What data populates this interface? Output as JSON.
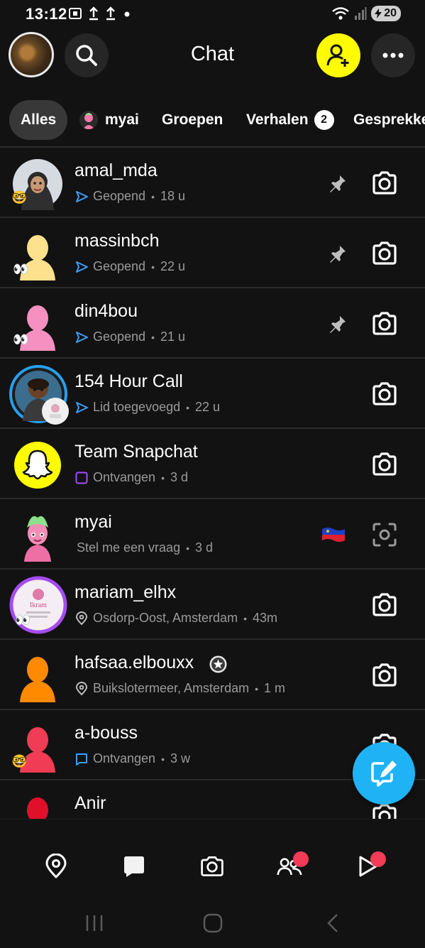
{
  "status_bar": {
    "time": "13:12",
    "battery": "20",
    "icons": [
      "screenshot-icon",
      "upload-icon",
      "upload-icon",
      "dot-icon",
      "wifi-icon",
      "signal-icon"
    ]
  },
  "header": {
    "title": "Chat"
  },
  "tabs": [
    {
      "label": "Alles",
      "active": true
    },
    {
      "label": "myai"
    },
    {
      "label": "Groepen"
    },
    {
      "label": "Verhalen",
      "badge": "2"
    },
    {
      "label": "Gesprekken"
    }
  ],
  "chats": [
    {
      "name": "amal_mda",
      "status_icon": "sent-arrow-blue",
      "status": "Geopend",
      "time": "18 u",
      "pinned": true,
      "action": "camera-icon"
    },
    {
      "name": "massinbch",
      "status_icon": "sent-arrow-blue",
      "status": "Geopend",
      "time": "22 u",
      "pinned": true,
      "action": "camera-icon"
    },
    {
      "name": "din4bou",
      "status_icon": "sent-arrow-blue",
      "status": "Geopend",
      "time": "21 u",
      "pinned": true,
      "action": "camera-icon"
    },
    {
      "name": "154 Hour Call",
      "status_icon": "sent-arrow-blue",
      "status": "Lid toegevoegd",
      "time": "22 u",
      "action": "camera-icon"
    },
    {
      "name": "Team Snapchat",
      "status_icon": "square-purple",
      "status": "Ontvangen",
      "time": "3 d",
      "action": "camera-icon"
    },
    {
      "name": "myai",
      "status": "Stel me een vraag",
      "time": "3 d",
      "flag": "liechtenstein-flag",
      "action": "scan-icon"
    },
    {
      "name": "mariam_elhx",
      "status_icon": "location-pin",
      "status": "Osdorp-Oost, Amsterdam",
      "time": "43m",
      "action": "camera-icon"
    },
    {
      "name": "hafsaa.elbouxx",
      "status_icon": "location-pin",
      "status": "Buikslotermeer, Amsterdam",
      "time": "1 m",
      "star_badge": true,
      "action": "camera-icon"
    },
    {
      "name": "a-bouss",
      "status_icon": "chat-blue",
      "status": "Ontvangen",
      "time": "3 w",
      "action": "camera-icon"
    },
    {
      "name": "Anir",
      "action": "camera-icon"
    }
  ],
  "colors": {
    "background": "#121212",
    "accent_yellow": "#fffc00",
    "fab_blue": "#1fb3f5",
    "sent_blue": "#3d9df5",
    "received_purple": "#a64cf0",
    "notification_red": "#f23c57"
  }
}
